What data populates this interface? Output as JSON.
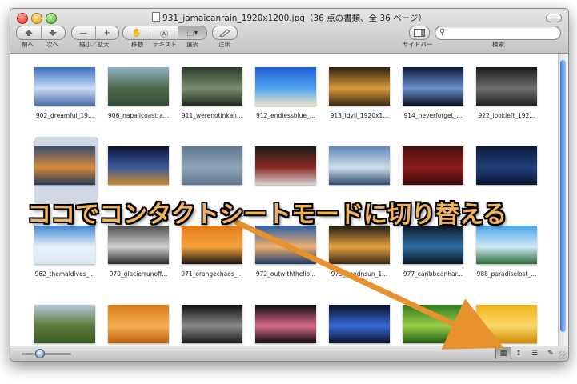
{
  "window": {
    "title": "931_jamaicanrain_1920x1200.jpg（36 点の書類、全 36 ページ）"
  },
  "toolbar": {
    "back_label": "前へ",
    "forward_label": "次へ",
    "zoom_label": "縮小／拡大",
    "zoom_out_glyph": "—",
    "zoom_in_glyph": "+",
    "tools": [
      "移動",
      "テキスト",
      "選択"
    ],
    "annotate_label": "注釈",
    "sidebar_label": "サイドバー",
    "search_label": "検索",
    "search_value": ""
  },
  "thumbnails": [
    {
      "caption": "902_dreamful_19...",
      "colors": [
        "#3b6fc4",
        "#c9dcf5",
        "#4a6ea6"
      ]
    },
    {
      "caption": "906_napalicoastra...",
      "colors": [
        "#8fb0c6",
        "#4f6a4a",
        "#2f4d38"
      ]
    },
    {
      "caption": "911_werenotinkan...",
      "colors": [
        "#2c3b2a",
        "#7b8d6e",
        "#1f2a1c"
      ]
    },
    {
      "caption": "912_endlessblue_...",
      "colors": [
        "#1f5fd6",
        "#4fa6f0",
        "#e8e2c8"
      ]
    },
    {
      "caption": "913_idyll_1920x1...",
      "colors": [
        "#2e2211",
        "#d89a3a",
        "#3a2a12"
      ]
    },
    {
      "caption": "914_neverforget_...",
      "colors": [
        "#0b1a3a",
        "#6c8fc9",
        "#0a1222"
      ]
    },
    {
      "caption": "922_lookleft_192...",
      "colors": [
        "#1a1a1a",
        "#6e6e6e",
        "#222"
      ]
    },
    {
      "caption": "",
      "colors": [
        "#3b4e6a",
        "#d78a3c",
        "#2a3a52"
      ]
    },
    {
      "caption": "",
      "colors": [
        "#0a1536",
        "#3e5a9a",
        "#c98a2e"
      ]
    },
    {
      "caption": "",
      "colors": [
        "#5f7790",
        "#8da4b8",
        "#5f7790"
      ]
    },
    {
      "caption": "",
      "colors": [
        "#1b1b1b",
        "#8b2a24",
        "#d4d4d4"
      ]
    },
    {
      "caption": "",
      "colors": [
        "#5f86b8",
        "#d0dde9",
        "#2d4a6f"
      ]
    },
    {
      "caption": "",
      "colors": [
        "#4a0f0f",
        "#8b1e1e",
        "#3a0a0a"
      ]
    },
    {
      "caption": "",
      "colors": [
        "#0c1a3c",
        "#21407a",
        "#0a1530"
      ]
    },
    {
      "caption": "962_themaldives_...",
      "colors": [
        "#3f86d1",
        "#e9f1f8",
        "#d9e9f1"
      ]
    },
    {
      "caption": "970_glacierrunoff...",
      "colors": [
        "#4d4d4d",
        "#cfcfcf",
        "#2a2a2a"
      ]
    },
    {
      "caption": "971_orangechaos_...",
      "colors": [
        "#e07b1a",
        "#f5a23c",
        "#1a1410"
      ]
    },
    {
      "caption": "972_outwiththelio...",
      "colors": [
        "#2b5fa8",
        "#f0b070",
        "#1e3b6a"
      ]
    },
    {
      "caption": "975_goodnsun_1...",
      "colors": [
        "#1f1a12",
        "#e4a040",
        "#3a2a14"
      ]
    },
    {
      "caption": "977_caribbeanhar...",
      "colors": [
        "#0e1a2c",
        "#2f6ea0",
        "#0a1422"
      ]
    },
    {
      "caption": "988_paradiselost_...",
      "colors": [
        "#49a6e8",
        "#cfe8f5",
        "#2e6e3a"
      ]
    },
    {
      "caption": "",
      "colors": [
        "#b7c7d8",
        "#5d7a3a",
        "#3d5a22"
      ]
    },
    {
      "caption": "",
      "colors": [
        "#d87a1a",
        "#f4b050",
        "#c06010"
      ]
    },
    {
      "caption": "",
      "colors": [
        "#0f0f0f",
        "#8a8a8a",
        "#1a1a1a"
      ]
    },
    {
      "caption": "",
      "colors": [
        "#0d0d0d",
        "#d86a8a",
        "#0d0d0d"
      ]
    },
    {
      "caption": "",
      "colors": [
        "#08102a",
        "#3a6ad8",
        "#08102a"
      ]
    },
    {
      "caption": "",
      "colors": [
        "#2f7a1e",
        "#9ad04a",
        "#1e5a10"
      ]
    },
    {
      "caption": "",
      "colors": [
        "#f2b418",
        "#f8d868",
        "#d08a08"
      ]
    }
  ],
  "annotation": {
    "banner_text": "ココでコンタクトシートモードに切り替える",
    "banner_color": "#f2b35a",
    "arrow_color": "#e8922e"
  },
  "statusbar": {
    "view_modes": [
      "contact-sheet",
      "list",
      "thumbnails",
      "annotate"
    ],
    "active_mode": "contact-sheet"
  }
}
